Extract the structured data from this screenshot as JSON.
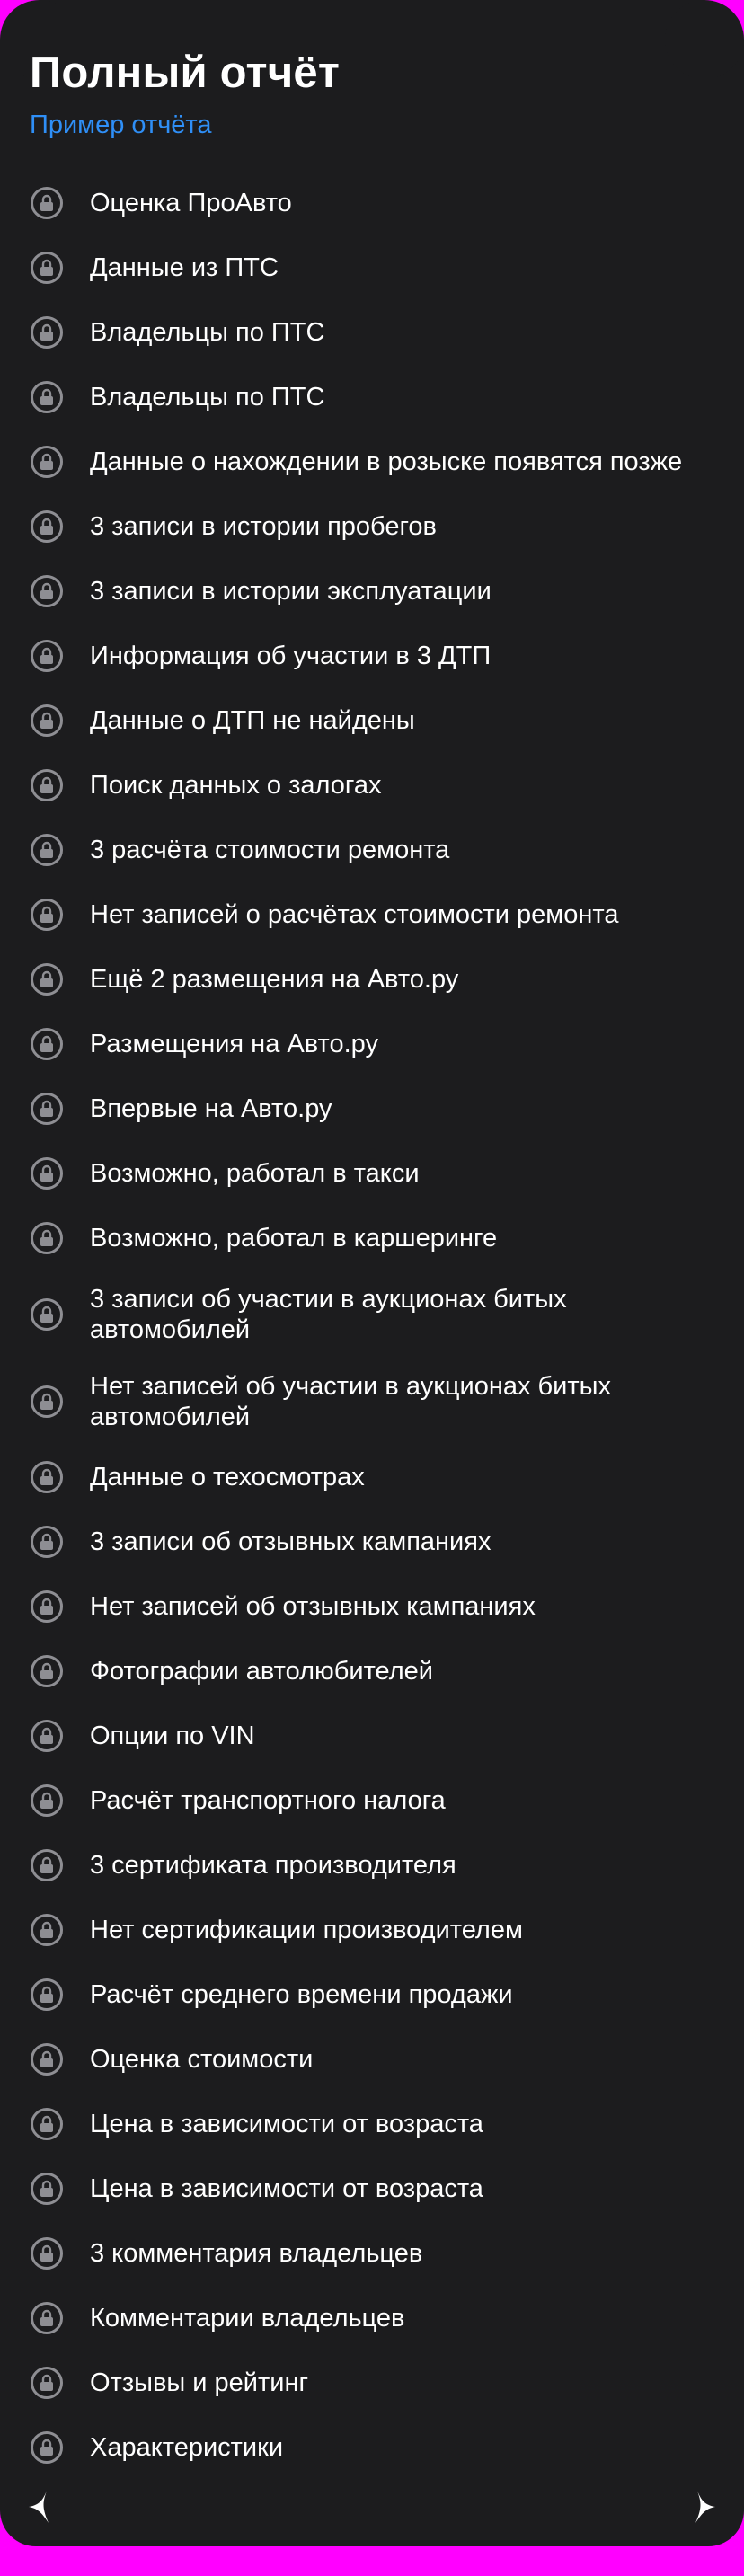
{
  "header": {
    "title": "Полный отчёт",
    "sample_link": "Пример отчёта"
  },
  "items": [
    {
      "label": "Оценка ПроАвто",
      "icon": "lock-icon"
    },
    {
      "label": "Данные из ПТС",
      "icon": "lock-icon"
    },
    {
      "label": "Владельцы по ПТС",
      "icon": "lock-icon"
    },
    {
      "label": "Владельцы по ПТС",
      "icon": "lock-icon"
    },
    {
      "label": "Данные о нахождении в розыске появятся позже",
      "icon": "lock-icon"
    },
    {
      "label": "3 записи в истории пробегов",
      "icon": "lock-icon"
    },
    {
      "label": "3 записи в истории эксплуатации",
      "icon": "lock-icon"
    },
    {
      "label": "Информация об участии в 3 ДТП",
      "icon": "lock-icon"
    },
    {
      "label": "Данные о ДТП не найдены",
      "icon": "lock-icon"
    },
    {
      "label": "Поиск данных о залогах",
      "icon": "lock-icon"
    },
    {
      "label": "3 расчёта стоимости ремонта",
      "icon": "lock-icon"
    },
    {
      "label": "Нет записей о расчётах стоимости ремонта",
      "icon": "lock-icon"
    },
    {
      "label": "Ещё 2 размещения на Авто.ру",
      "icon": "lock-icon"
    },
    {
      "label": "Размещения на Авто.ру",
      "icon": "lock-icon"
    },
    {
      "label": "Впервые на Авто.ру",
      "icon": "lock-icon"
    },
    {
      "label": "Возможно, работал в такси",
      "icon": "lock-icon"
    },
    {
      "label": "Возможно, работал в каршеринге",
      "icon": "lock-icon"
    },
    {
      "label": "3 записи об участии в аукционах битых автомобилей",
      "icon": "lock-icon"
    },
    {
      "label": "Нет записей об участии в аукционах битых автомобилей",
      "icon": "lock-icon"
    },
    {
      "label": "Данные о техосмотрах",
      "icon": "lock-icon"
    },
    {
      "label": "3 записи об отзывных кампаниях",
      "icon": "lock-icon"
    },
    {
      "label": "Нет записей об отзывных кампаниях",
      "icon": "lock-icon"
    },
    {
      "label": "Фотографии автолюбителей",
      "icon": "lock-icon"
    },
    {
      "label": "Опции по VIN",
      "icon": "lock-icon"
    },
    {
      "label": "Расчёт транспортного налога",
      "icon": "lock-icon"
    },
    {
      "label": "3 сертификата производителя",
      "icon": "lock-icon"
    },
    {
      "label": "Нет сертификации производителем",
      "icon": "lock-icon"
    },
    {
      "label": "Расчёт среднего времени продажи",
      "icon": "lock-icon"
    },
    {
      "label": "Оценка стоимости",
      "icon": "lock-icon"
    },
    {
      "label": "Цена в зависимости от возраста",
      "icon": "lock-icon"
    },
    {
      "label": "Цена в зависимости от возраста",
      "icon": "lock-icon"
    },
    {
      "label": "3 комментария владельцев",
      "icon": "lock-icon"
    },
    {
      "label": "Комментарии владельцев",
      "icon": "lock-icon"
    },
    {
      "label": "Отзывы и рейтинг",
      "icon": "lock-icon"
    },
    {
      "label": "Характеристики",
      "icon": "lock-icon"
    }
  ],
  "colors": {
    "background": "#1c1c1e",
    "text": "#ffffff",
    "link": "#2f8ff7",
    "icon": "#8e8e93",
    "frame": "#ff00ff"
  }
}
